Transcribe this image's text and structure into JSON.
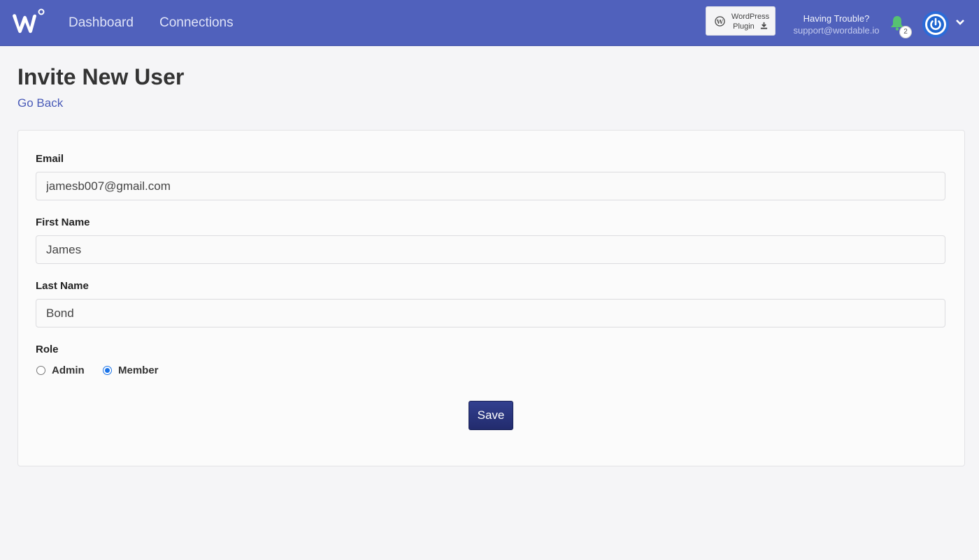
{
  "nav": {
    "dashboard": "Dashboard",
    "connections": "Connections",
    "wp_plugin_line1": "WordPress",
    "wp_plugin_line2": "Plugin",
    "help_title": "Having Trouble?",
    "help_email": "support@wordable.io",
    "notification_count": "2"
  },
  "page": {
    "title": "Invite New User",
    "back_link": "Go Back"
  },
  "form": {
    "email_label": "Email",
    "email_value": "jamesb007@gmail.com",
    "first_name_label": "First Name",
    "first_name_value": "James",
    "last_name_label": "Last Name",
    "last_name_value": "Bond",
    "role_label": "Role",
    "roles": [
      {
        "label": "Admin",
        "selected": false
      },
      {
        "label": "Member",
        "selected": true
      }
    ],
    "save_label": "Save"
  },
  "colors": {
    "topbar": "#5061bc",
    "save_button": "#2a3580",
    "link": "#4a5bb8",
    "bell": "#56c271",
    "avatar": "#2a6bd8"
  },
  "icons": [
    "wordable-logo",
    "wordpress-icon",
    "download-icon",
    "bell-icon",
    "power-icon",
    "chevron-down-icon"
  ]
}
